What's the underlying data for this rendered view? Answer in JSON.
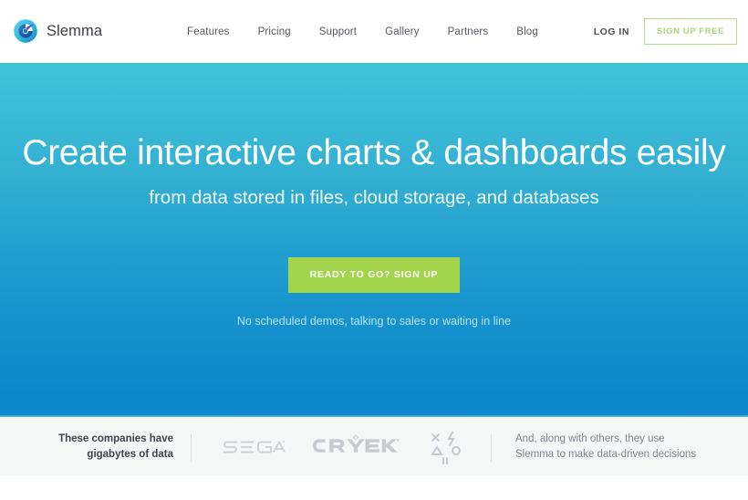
{
  "header": {
    "brand_name": "Slemma",
    "brand_icon": "slemma-swirl-logo-icon",
    "nav": [
      {
        "label": "Features"
      },
      {
        "label": "Pricing"
      },
      {
        "label": "Support"
      },
      {
        "label": "Gallery"
      },
      {
        "label": "Partners"
      },
      {
        "label": "Blog"
      }
    ],
    "login_label": "LOG IN",
    "signup_label": "SIGN UP FREE",
    "signup_border_color": "#b6d98a",
    "signup_text_color": "#aed37e"
  },
  "hero": {
    "title": "Create interactive charts & dashboards easily",
    "subtitle": "from data stored in files, cloud storage, and databases",
    "cta_label": "READY TO GO? SIGN UP",
    "cta_color": "#a2d44c",
    "note_line1": "No scheduled demos, talking",
    "note_line2": "to sales or waiting in line",
    "gradient_top": "#3fc3da",
    "gradient_bottom": "#0d86cd"
  },
  "band": {
    "lead_line1": "These companies have",
    "lead_line2": "gigabytes of data",
    "logos": [
      {
        "name": "sega-logo",
        "label": "SEGA"
      },
      {
        "name": "crytek-logo",
        "label": "CRYTEK"
      },
      {
        "name": "glyph-cluster-logo",
        "label": ""
      }
    ],
    "tail_line1": "And, along with others, they use",
    "tail_line2": "Slemma to make data-driven decisions",
    "background": "#f5f6f6",
    "logo_color": "#c8cdd2"
  }
}
